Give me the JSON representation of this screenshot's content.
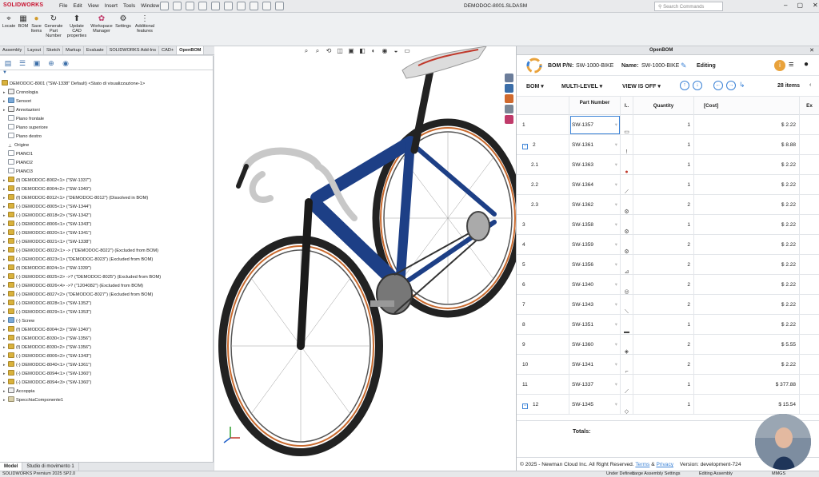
{
  "app": {
    "logo": "SOLIDWORKS",
    "menus": [
      "File",
      "Edit",
      "View",
      "Insert",
      "Tools",
      "Window"
    ],
    "document_title": "DEMODOC-8001.SLDASM",
    "search_placeholder": "Search Commands"
  },
  "commands": [
    {
      "label": "Locate",
      "icon": "pin-icon"
    },
    {
      "label": "BOM",
      "icon": "grid-icon"
    },
    {
      "label": "Save Items",
      "icon": "save-items-icon"
    },
    {
      "label": "Generate Part Number",
      "icon": "refresh-icon"
    },
    {
      "label": "Update CAD properties",
      "icon": "upload-icon"
    },
    {
      "label": "Workspace Manager",
      "icon": "workspace-icon"
    },
    {
      "label": "Settings",
      "icon": "gear-icon"
    },
    {
      "label": "Additional features",
      "icon": "more-icon"
    }
  ],
  "tabs": [
    "Assembly",
    "Layout",
    "Sketch",
    "Markup",
    "Evaluate",
    "SOLIDWORKS Add-Ins",
    "CAD+",
    "OpenBOM"
  ],
  "active_tab": "OpenBOM",
  "tree": {
    "root": "DEMODOC-8001 (\"SW-1338\" Default) <Stato di visualizzazione-1>",
    "items": [
      {
        "text": "Cronologia",
        "icon": "note"
      },
      {
        "text": "Sensori",
        "icon": "fold"
      },
      {
        "text": "Annotazioni",
        "icon": "note"
      },
      {
        "text": "Piano frontale",
        "icon": "pln"
      },
      {
        "text": "Piano superiore",
        "icon": "pln"
      },
      {
        "text": "Piano destro",
        "icon": "pln"
      },
      {
        "text": "Origine",
        "icon": "org"
      },
      {
        "text": "PIANO1",
        "icon": "pln"
      },
      {
        "text": "PIANO2",
        "icon": "pln"
      },
      {
        "text": "PIANO3",
        "icon": "pln"
      },
      {
        "text": "(f) DEMODOC-8002<1> (\"SW-1337\")",
        "icon": "asm"
      },
      {
        "text": "(f) DEMODOC-8004<2> (\"SW-1340\")",
        "icon": "asm"
      },
      {
        "text": "(f) DEMODOC-8012<1> (\"DEMODOC-8012\") (Dissolved in BOM)",
        "icon": "asm"
      },
      {
        "text": "(-) DEMODOC-8005<1> (\"SW-1344\")",
        "icon": "asm"
      },
      {
        "text": "(-) DEMODOC-8018<2> (\"SW-1342\")",
        "icon": "asm"
      },
      {
        "text": "(-) DEMODOC-8006<1> (\"SW-1343\")",
        "icon": "asm"
      },
      {
        "text": "(-) DEMODOC-8020<1> (\"SW-1341\")",
        "icon": "asm"
      },
      {
        "text": "(-) DEMODOC-8021<1> (\"SW-1338\")",
        "icon": "asm"
      },
      {
        "text": "(-) DEMODOC-8022<1> -> (\"DEMODOC-8022\") (Excluded from BOM)",
        "icon": "asm"
      },
      {
        "text": "(-) DEMODOC-8023<1> (\"DEMODOC-8023\") (Excluded from BOM)",
        "icon": "asm"
      },
      {
        "text": "(f) DEMODOC-8024<1> (\"SW-1339\")",
        "icon": "asm"
      },
      {
        "text": "(-) DEMODOC-8025<2> ->? (\"DEMODOC-8025\") (Excluded from BOM)",
        "icon": "asm"
      },
      {
        "text": "(-) DEMODOC-8026<4> ->? (\"1204082\") (Excluded from BOM)",
        "icon": "asm"
      },
      {
        "text": "(-) DEMODOC-8027<2> (\"DEMODOC-8027\") (Excluded from BOM)",
        "icon": "asm"
      },
      {
        "text": "(-) DEMODOC-8028<1> (\"SW-1352\")",
        "icon": "asm"
      },
      {
        "text": "(-) DEMODOC-8029<1> (\"SW-1353\")",
        "icon": "asm"
      },
      {
        "text": "(-) Screw",
        "icon": "fold"
      },
      {
        "text": "(f) DEMODOC-8004<3> (\"SW-1340\")",
        "icon": "asm"
      },
      {
        "text": "(f) DEMODOC-8030<1> (\"SW-1356\")",
        "icon": "asm"
      },
      {
        "text": "(f) DEMODOC-8030<2> (\"SW-1356\")",
        "icon": "asm"
      },
      {
        "text": "(-) DEMODOC-8006<2> (\"SW-1343\")",
        "icon": "asm"
      },
      {
        "text": "(-) DEMODOC-8040<1> (\"SW-1361\")",
        "icon": "asm"
      },
      {
        "text": "(-) DEMODOC-8094<1> (\"SW-1360\")",
        "icon": "asm"
      },
      {
        "text": "(-) DEMODOC-8094<3> (\"SW-1360\")",
        "icon": "asm"
      },
      {
        "text": "Accoppia",
        "icon": "note"
      },
      {
        "text": "SpecchiaComponente1",
        "icon": "part"
      }
    ]
  },
  "fm_bottom_tabs": [
    "Model",
    "Studio di movimento 1"
  ],
  "openbom": {
    "panel_title": "OpenBOM",
    "bom_pn_label": "BOM P/N:",
    "bom_pn_value": "SW-1000-BIKE",
    "name_label": "Name:",
    "name_value": "SW-1000-BIKE",
    "mode": "Editing",
    "toolbar": {
      "bom": "BOM",
      "level": "MULTI-LEVEL",
      "view": "VIEW IS OFF",
      "count": "28 items"
    },
    "columns": {
      "part_number": "Part Number",
      "img": "I..",
      "quantity": "Quantity",
      "cost": "[Cost]",
      "extra": "Ex"
    },
    "rows": [
      {
        "idx": "1",
        "pn": "SW-1357",
        "qty": "1",
        "cost": "$ 2.22"
      },
      {
        "idx": "2",
        "pn": "SW-1361",
        "qty": "1",
        "cost": "$ 8.88"
      },
      {
        "idx": "2.1",
        "pn": "SW-1363",
        "qty": "1",
        "cost": "$ 2.22"
      },
      {
        "idx": "2.2",
        "pn": "SW-1364",
        "qty": "1",
        "cost": "$ 2.22"
      },
      {
        "idx": "2.3",
        "pn": "SW-1362",
        "qty": "2",
        "cost": "$ 2.22"
      },
      {
        "idx": "3",
        "pn": "SW-1358",
        "qty": "1",
        "cost": "$ 2.22"
      },
      {
        "idx": "4",
        "pn": "SW-1359",
        "qty": "2",
        "cost": "$ 2.22"
      },
      {
        "idx": "5",
        "pn": "SW-1356",
        "qty": "2",
        "cost": "$ 2.22"
      },
      {
        "idx": "6",
        "pn": "SW-1340",
        "qty": "2",
        "cost": "$ 2.22"
      },
      {
        "idx": "7",
        "pn": "SW-1343",
        "qty": "2",
        "cost": "$ 2.22"
      },
      {
        "idx": "8",
        "pn": "SW-1351",
        "qty": "1",
        "cost": "$ 2.22"
      },
      {
        "idx": "9",
        "pn": "SW-1360",
        "qty": "2",
        "cost": "$ 5.55"
      },
      {
        "idx": "10",
        "pn": "SW-1341",
        "qty": "2",
        "cost": "$ 2.22"
      },
      {
        "idx": "11",
        "pn": "SW-1337",
        "qty": "1",
        "cost": "$ 377.88"
      },
      {
        "idx": "12",
        "pn": "SW-1345",
        "qty": "1",
        "cost": "$ 15.54"
      }
    ],
    "totals_label": "Totals:",
    "footer": {
      "copyright": "© 2025 - Newman Cloud Inc. All Right Reserved.",
      "terms": "Terms",
      "amp": "&",
      "privacy": "Privacy",
      "version": "Version: development-724"
    }
  },
  "status": {
    "product": "SOLIDWORKS Premium 2025 SP2.0",
    "state": "Under Defined",
    "large_assembly": "Large Assembly Settings",
    "editing": "Editing Assembly",
    "units": "MMGS"
  },
  "colors": {
    "accent": "#3b82d6",
    "frame": "#1d3f86",
    "tire": "#c96a2e"
  }
}
